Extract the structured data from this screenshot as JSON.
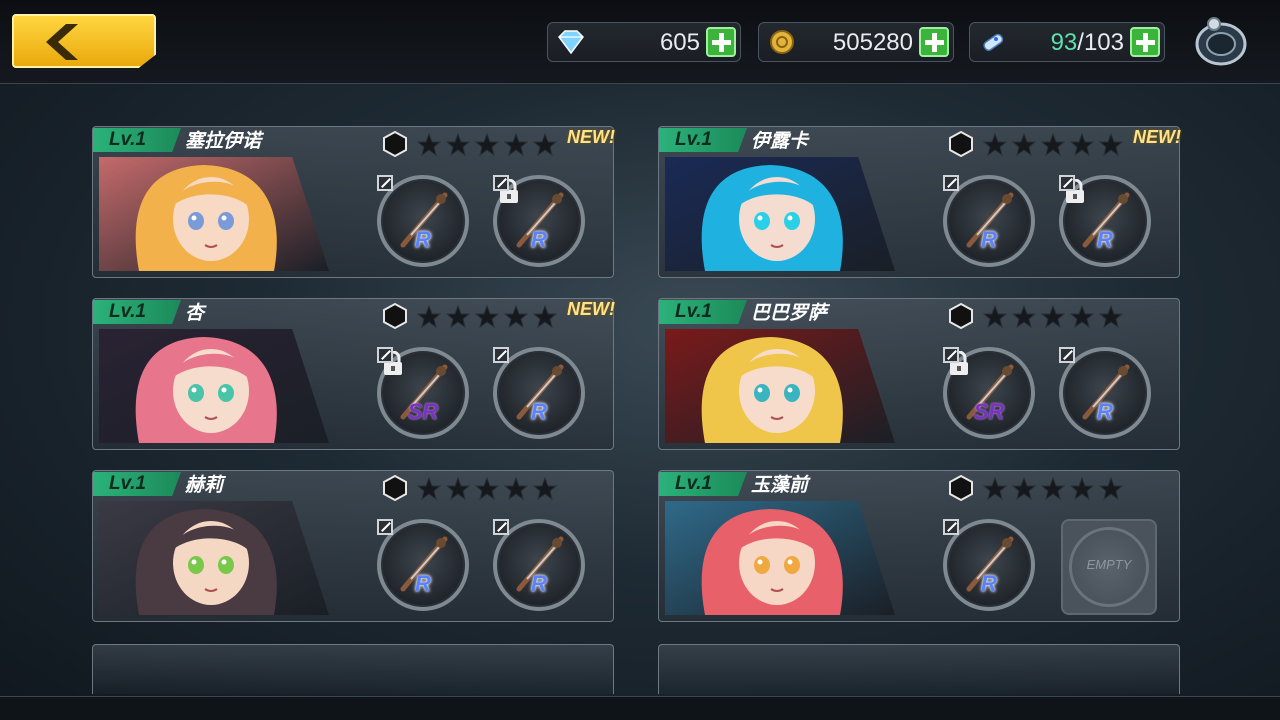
{
  "topbar": {
    "back_icon": "chevron-left-icon",
    "resources": {
      "gems": {
        "icon": "diamond-icon",
        "value": "605"
      },
      "coins": {
        "icon": "coin-icon",
        "value": "505280"
      },
      "stamina": {
        "icon": "stamina-icon",
        "current": "93",
        "separator": "/",
        "max": "103"
      }
    },
    "settings_icon": "settings-icon"
  },
  "characters": [
    {
      "level": "Lv.1",
      "name": "塞拉伊诺",
      "stars": 0,
      "new": "NEW!",
      "portrait": {
        "hair": "#f2b14a",
        "skin": "#f7d9c4",
        "bg": "#c46a6a",
        "eye": "#7a9ad8"
      },
      "slots": [
        {
          "rarity": "R",
          "locked": false
        },
        {
          "rarity": "R",
          "locked": true
        }
      ]
    },
    {
      "level": "Lv.1",
      "name": "伊露卡",
      "stars": 0,
      "new": "NEW!",
      "portrait": {
        "hair": "#1fb2e0",
        "skin": "#f4ddd0",
        "bg": "#1a2a55",
        "eye": "#2ad0e8"
      },
      "slots": [
        {
          "rarity": "R",
          "locked": false
        },
        {
          "rarity": "R",
          "locked": true
        }
      ]
    },
    {
      "level": "Lv.1",
      "name": "杏",
      "stars": 0,
      "new": "NEW!",
      "portrait": {
        "hair": "#e7768c",
        "skin": "#f6dccc",
        "bg": "#2a2233",
        "eye": "#4ac4a8"
      },
      "slots": [
        {
          "rarity": "SR",
          "locked": true
        },
        {
          "rarity": "R",
          "locked": false
        }
      ]
    },
    {
      "level": "Lv.1",
      "name": "巴巴罗萨",
      "stars": 0,
      "new": "",
      "portrait": {
        "hair": "#f0c64a",
        "skin": "#f7dccb",
        "bg": "#7a1a1a",
        "eye": "#3ab4c0"
      },
      "slots": [
        {
          "rarity": "SR",
          "locked": true
        },
        {
          "rarity": "R",
          "locked": false
        }
      ]
    },
    {
      "level": "Lv.1",
      "name": "赫莉",
      "stars": 0,
      "new": "",
      "portrait": {
        "hair": "#4a3a42",
        "skin": "#f4d8c4",
        "bg": "#3a3a44",
        "eye": "#7ac84a"
      },
      "slots": [
        {
          "rarity": "R",
          "locked": false
        },
        {
          "rarity": "R",
          "locked": false
        }
      ]
    },
    {
      "level": "Lv.1",
      "name": "玉藻前",
      "stars": 0,
      "new": "",
      "portrait": {
        "hair": "#e8606a",
        "skin": "#f6d6c4",
        "bg": "#2f6a8a",
        "eye": "#f0a840"
      },
      "slots": [
        {
          "rarity": "R",
          "locked": false
        },
        {
          "rarity": "",
          "locked": false,
          "empty": "EMPTY"
        }
      ]
    }
  ],
  "colors": {
    "accent_yellow": "#ffd640",
    "level_green": "#2bb27a",
    "rarity_r": "#5a82ff",
    "rarity_sr": "#7a32c0"
  }
}
